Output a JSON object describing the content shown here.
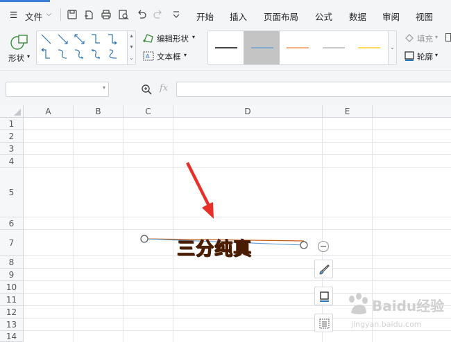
{
  "menubar": {
    "file_label": "文件",
    "tabs": [
      "开始",
      "插入",
      "页面布局",
      "公式",
      "数据",
      "审阅",
      "视图"
    ]
  },
  "ribbon": {
    "shape_label": "形状",
    "edit_shape_label": "编辑形状",
    "textbox_label": "文本框",
    "fill_label": "填充",
    "outline_label": "轮廓",
    "line_style_colors": [
      "#000000",
      "#5b9bd5",
      "#ed7d31",
      "#a5a5a5",
      "#ffc000"
    ]
  },
  "formula_bar": {
    "fx_label": "fx",
    "name_box_value": "",
    "formula_value": ""
  },
  "sheet": {
    "columns": [
      "A",
      "B",
      "C",
      "D",
      "E"
    ],
    "rows": [
      "1",
      "2",
      "3",
      "4",
      "5",
      "6",
      "7",
      "8",
      "9",
      "10",
      "11",
      "12",
      "13",
      "14"
    ]
  },
  "wordart": {
    "text": "三分纯真",
    "color": "#8b3a0a"
  },
  "annotation": {
    "arrow_color": "#e8302a"
  },
  "watermark": {
    "brand": "Baidu经验",
    "url": "jingyan.baidu.com"
  }
}
